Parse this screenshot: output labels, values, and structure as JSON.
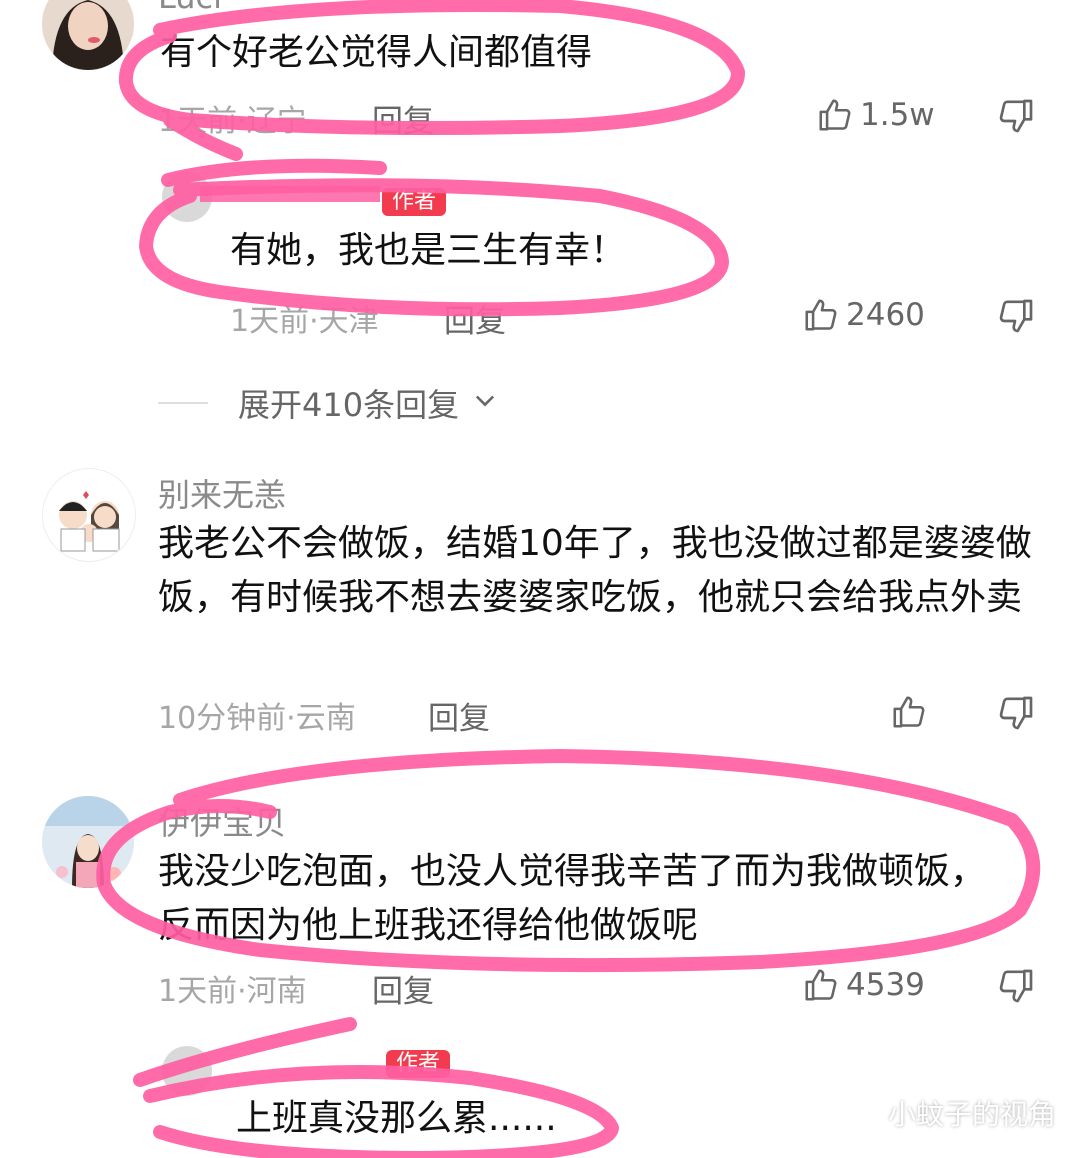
{
  "comments": [
    {
      "username": "Luci",
      "text": "有个好老公觉得人间都值得",
      "time_location": "1天前·辽宁",
      "reply_label": "回复",
      "likes": "1.5w"
    },
    {
      "author_badge": "作者",
      "text": "有她，我也是三生有幸！",
      "time_location": "1天前·天津",
      "reply_label": "回复",
      "likes": "2460"
    },
    {
      "username": "别来无恙",
      "text": "我老公不会做饭，结婚10年了，我也没做过都是婆婆做饭，有时候我不想去婆婆家吃饭，他就只会给我点外卖",
      "time_location": "10分钟前·云南",
      "reply_label": "回复",
      "likes": ""
    },
    {
      "username": "伊伊宝贝",
      "text": "我没少吃泡面，也没人觉得我辛苦了而为我做顿饭，反而因为他上班我还得给他做饭呢",
      "time_location": "1天前·河南",
      "reply_label": "回复",
      "likes": "4539"
    },
    {
      "author_badge": "作者",
      "text": "上班真没那么累......"
    }
  ],
  "expand_replies": "展开410条回复",
  "watermark": "小蚊子的视角",
  "colors": {
    "marker": "#ff5fa2",
    "badge": "#f23b4f"
  },
  "icons": [
    "thumb-up-icon",
    "thumb-down-icon",
    "chevron-down-icon",
    "wechat-icon"
  ]
}
